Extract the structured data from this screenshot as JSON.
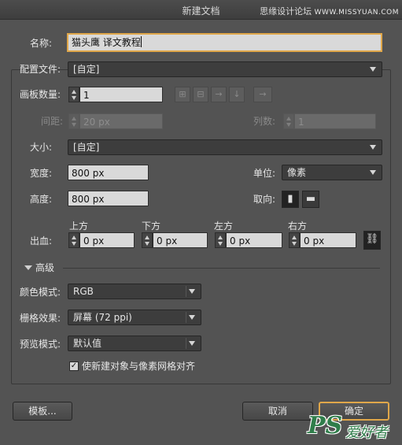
{
  "window": {
    "title": "新建文档",
    "watermark": "思缘设计论坛",
    "watermark_site": "WWW.MISSYUAN.COM"
  },
  "name_row": {
    "label": "名称:",
    "value": "猫头鹰 译文教程"
  },
  "profile_row": {
    "label": "配置文件:",
    "value": "[自定]"
  },
  "artboards_row": {
    "label": "画板数量:",
    "value": "1"
  },
  "spacing_row": {
    "label": "间距:",
    "value": "20 px",
    "columns_label": "列数:",
    "columns_value": "1"
  },
  "size_row": {
    "label": "大小:",
    "value": "[自定]"
  },
  "width_row": {
    "label": "宽度:",
    "value": "800 px",
    "units_label": "单位:",
    "units_value": "像素"
  },
  "height_row": {
    "label": "高度:",
    "value": "800 px",
    "orientation_label": "取向:"
  },
  "bleed": {
    "label": "出血:",
    "top_label": "上方",
    "top_value": "0 px",
    "bottom_label": "下方",
    "bottom_value": "0 px",
    "left_label": "左方",
    "left_value": "0 px",
    "right_label": "右方",
    "right_value": "0 px"
  },
  "advanced": {
    "label": "高级",
    "color_mode_label": "颜色模式:",
    "color_mode_value": "RGB",
    "raster_label": "栅格效果:",
    "raster_value": "屏幕 (72 ppi)",
    "preview_label": "预览模式:",
    "preview_value": "默认值",
    "align_checkbox_label": "使新建对象与像素网格对齐",
    "align_checked": true
  },
  "buttons": {
    "templates": "模板...",
    "cancel": "取消",
    "ok": "确定"
  },
  "logo": {
    "text": "PS",
    "subtext": "爱好者"
  },
  "icons": {
    "grid_by_row": "grid-by-row-icon",
    "grid_by_column": "grid-by-column-icon",
    "arrange_by_row": "arrange-by-row-icon",
    "arrange_by_column": "arrange-by-column-icon",
    "rtl": "right-to-left-icon",
    "portrait": "portrait-icon",
    "landscape": "landscape-icon",
    "link": "link-icon"
  },
  "colors": {
    "accent": "#e0a74a",
    "panel_bg": "#535353"
  }
}
